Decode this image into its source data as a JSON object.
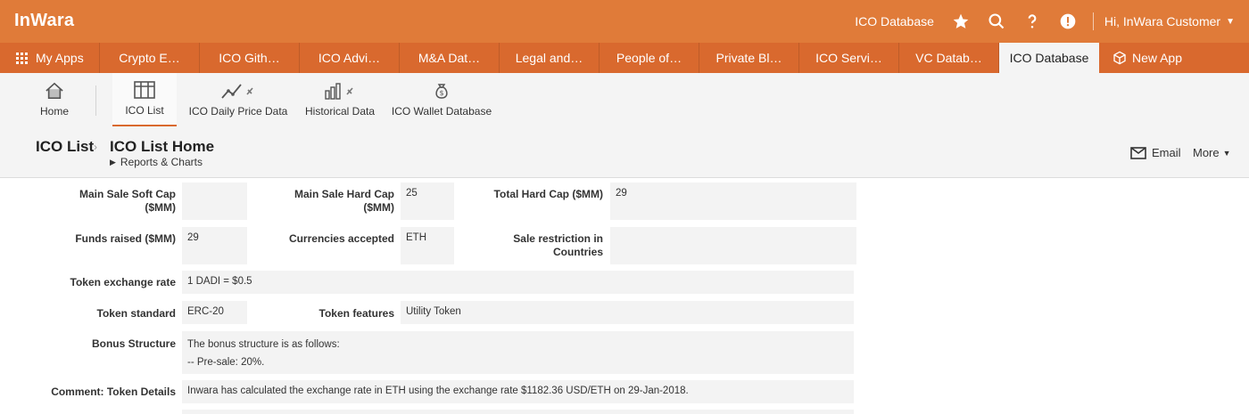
{
  "header": {
    "brand": "InWara",
    "db_link": "ICO Database",
    "greeting": "Hi, InWara Customer"
  },
  "apptabs": {
    "my_apps": "My Apps",
    "items": [
      "Crypto E…",
      "ICO Gith…",
      "ICO Advi…",
      "M&A Dat…",
      "Legal and…",
      "People of…",
      "Private Bl…",
      "ICO Servi…",
      "VC Datab…"
    ],
    "active": "ICO Database",
    "new_app": "New App"
  },
  "subnav": {
    "home": "Home",
    "ico_list": "ICO List",
    "daily_price": "ICO Daily Price Data",
    "historical": "Historical Data",
    "wallet": "ICO Wallet Database"
  },
  "page": {
    "breadcrumb": "ICO List",
    "title": "ICO List Home",
    "reports": "Reports & Charts",
    "email": "Email",
    "more": "More"
  },
  "form": {
    "soft_cap": {
      "label1": "Main Sale Soft Cap",
      "label2": "($MM)",
      "value": ""
    },
    "hard_cap": {
      "label1": "Main Sale Hard Cap",
      "label2": "($MM)",
      "value": "25"
    },
    "total_hard_cap": {
      "label": "Total Hard Cap ($MM)",
      "value": "29"
    },
    "funds_raised": {
      "label": "Funds raised ($MM)",
      "value": "29"
    },
    "currencies": {
      "label": "Currencies accepted",
      "value": "ETH"
    },
    "sale_restriction": {
      "label1": "Sale restriction in",
      "label2": "Countries",
      "value": ""
    },
    "exchange_rate": {
      "label": "Token exchange rate",
      "value": "1 DADI = $0.5"
    },
    "token_standard": {
      "label": "Token standard",
      "value": "ERC-20"
    },
    "token_features": {
      "label": "Token features",
      "value": "Utility Token"
    },
    "bonus": {
      "label": "Bonus Structure",
      "line1": "The bonus structure is as follows:",
      "line2": "-- Pre-sale: 20%."
    },
    "comment": {
      "label": "Comment: Token Details",
      "value": "Inwara has calculated the exchange rate in ETH using the exchange rate $1182.36 USD/ETH on 29-Jan-2018."
    }
  },
  "colors": {
    "brand_orange": "#e07b39",
    "tab_orange": "#d9692e"
  }
}
